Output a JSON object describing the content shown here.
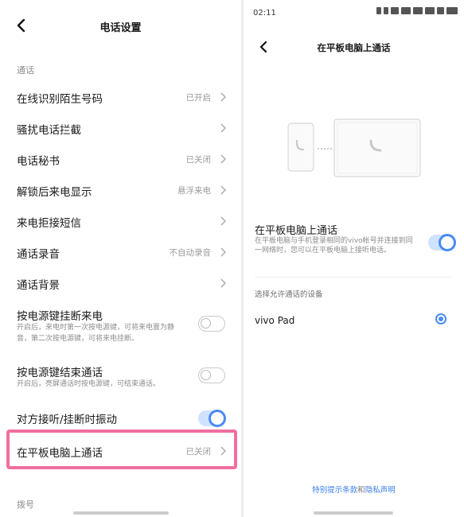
{
  "left": {
    "title": "电话设置",
    "section_calls": "通话",
    "rows": [
      {
        "title": "在线识别陌生号码",
        "value": "已开启"
      },
      {
        "title": "骚扰电话拦截",
        "value": ""
      },
      {
        "title": "电话秘书",
        "value": "已关闭"
      },
      {
        "title": "解锁后来电显示",
        "value": "悬浮来电"
      },
      {
        "title": "来电拒接短信",
        "value": ""
      },
      {
        "title": "通话录音",
        "value": "不自动录音"
      },
      {
        "title": "通话背景",
        "value": ""
      }
    ],
    "power_end_incoming": {
      "title": "按电源键挂断来电",
      "desc": "开启后，来电时第一次按电源键，可将来电置为静音，第二次按电源键，可将来电挂断。",
      "enabled": false
    },
    "power_end_call": {
      "title": "按电源键结束通话",
      "desc": "开启后，亮屏通话时按电源键，可结束通话。",
      "enabled": false
    },
    "vibrate": {
      "title": "对方接听/挂断时振动",
      "enabled": true
    },
    "tablet_call": {
      "title": "在平板电脑上通话",
      "value": "已关闭"
    },
    "section_dial": "拨号"
  },
  "right": {
    "status_time": "02:11",
    "title": "在平板电脑上通话",
    "toggle_row": {
      "title": "在平板电脑上通话",
      "desc": "在平板电脑与手机登录相同的vivo帐号并连接到同一网络时，您可以在平板电脑上接听电话。",
      "enabled": true
    },
    "section": "选择允许通话的设备",
    "device": {
      "name": "vivo Pad",
      "selected": true
    },
    "links": {
      "terms": "特别提示条款",
      "and": "和",
      "privacy": "隐私声明"
    }
  },
  "colors": {
    "accent": "#4a8af4",
    "highlight": "#f06ea0"
  }
}
